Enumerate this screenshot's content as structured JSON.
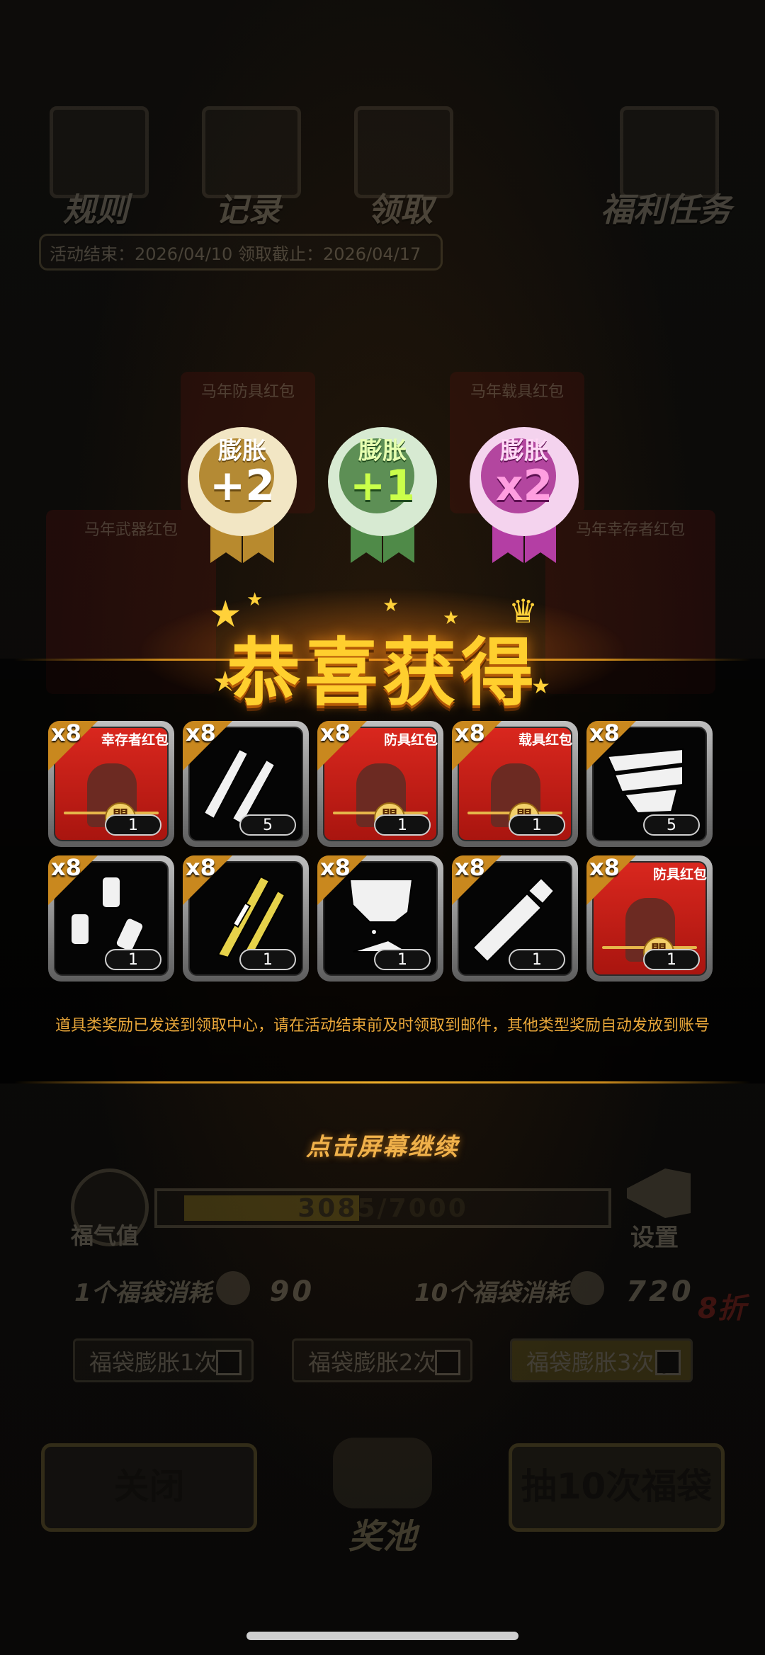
{
  "top_nav": [
    {
      "label": "规则"
    },
    {
      "label": "记录"
    },
    {
      "label": "领取"
    },
    {
      "label": "福利任务"
    }
  ],
  "dates": "活动结束：2026/04/10  领取截止：2026/04/17",
  "bg_cards": [
    "马年防具红包",
    "马年载具红包",
    "马年武器红包",
    "马年幸存者红包"
  ],
  "badges": [
    {
      "word": "膨胀",
      "value": "+2",
      "color": "#c9a24c"
    },
    {
      "word": "膨胀",
      "value": "+1",
      "color": "#5f9a5a"
    },
    {
      "word": "膨胀",
      "value": "x2",
      "color": "#c14fb0"
    }
  ],
  "banner_title": "恭喜获得",
  "items": [
    {
      "mult": "x8",
      "title": "幸存者红包",
      "qty": "1",
      "type": "envelope",
      "icon": "survivor-envelope-icon"
    },
    {
      "mult": "x8",
      "title": "",
      "qty": "5",
      "type": "bullets",
      "icon": "bullets-icon"
    },
    {
      "mult": "x8",
      "title": "防具红包",
      "qty": "1",
      "type": "envelope",
      "icon": "armor-envelope-icon"
    },
    {
      "mult": "x8",
      "title": "载具红包",
      "qty": "1",
      "type": "envelope",
      "icon": "vehicle-envelope-icon"
    },
    {
      "mult": "x8",
      "title": "",
      "qty": "5",
      "type": "tape",
      "icon": "tape-icon"
    },
    {
      "mult": "x8",
      "title": "",
      "qty": "1",
      "type": "bottles",
      "icon": "bottles-icon"
    },
    {
      "mult": "x8",
      "title": "",
      "qty": "1",
      "type": "syringe",
      "icon": "syringe-icon"
    },
    {
      "mult": "x8",
      "title": "",
      "qty": "1",
      "type": "cloth",
      "icon": "cloth-icon"
    },
    {
      "mult": "x8",
      "title": "",
      "qty": "1",
      "type": "tube",
      "icon": "tube-icon"
    },
    {
      "mult": "x8",
      "title": "防具红包",
      "qty": "1",
      "type": "envelope",
      "icon": "armor-envelope-icon"
    }
  ],
  "seal_char": "開",
  "notice": "道具类奖励已发送到领取中心，请在活动结束前及时领取到邮件，其他类型奖励自动发放到账号",
  "continue": "点击屏幕继续",
  "fuqi_label": "福气值",
  "progress": {
    "text": "3085/7000",
    "current": 3085,
    "max": 7000
  },
  "settings_label": "设置",
  "cost1": {
    "label": "1个福袋消耗",
    "value": "90"
  },
  "cost10": {
    "label": "10个福袋消耗",
    "value": "720"
  },
  "discount": "8折",
  "toggles": [
    {
      "label": "福袋膨胀1次",
      "checked": false
    },
    {
      "label": "福袋膨胀2次",
      "checked": false
    },
    {
      "label": "福袋膨胀3次",
      "checked": true
    }
  ],
  "close_button": "关闭",
  "draw_button": "抽10次福袋",
  "pool_label": "奖池"
}
